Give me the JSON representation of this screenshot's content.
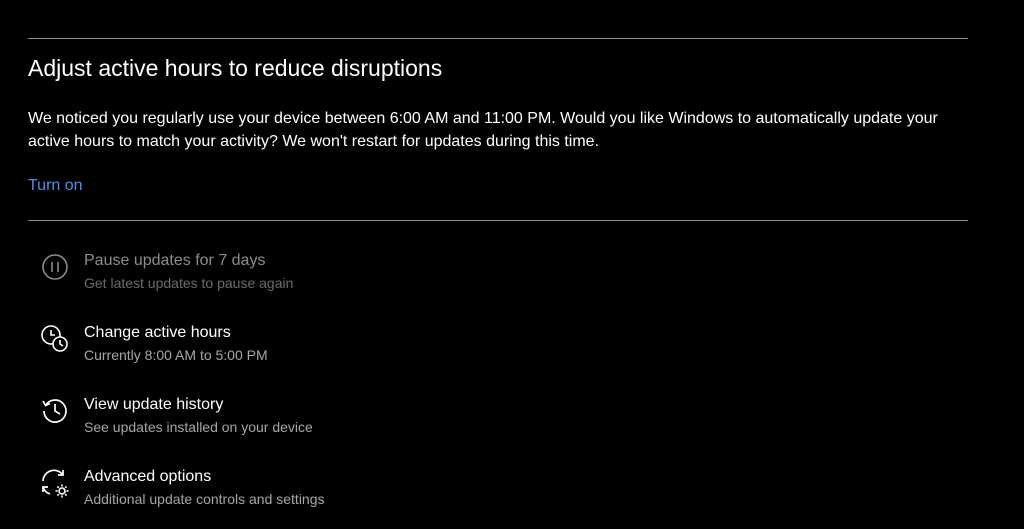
{
  "active_hours_prompt": {
    "heading": "Adjust active hours to reduce disruptions",
    "description": "We noticed you regularly use your device between 6:00 AM and 11:00 PM. Would you like Windows to automatically update your active hours to match your activity? We won't restart for updates during this time.",
    "turn_on_link": "Turn on",
    "link_color": "#4d8ee6"
  },
  "options": [
    {
      "icon": "pause-icon",
      "title": "Pause updates for 7 days",
      "subtitle": "Get latest updates to pause again",
      "enabled": false
    },
    {
      "icon": "active-hours-clock-icon",
      "title": "Change active hours",
      "subtitle": "Currently 8:00 AM to 5:00 PM",
      "enabled": true
    },
    {
      "icon": "history-icon",
      "title": "View update history",
      "subtitle": "See updates installed on your device",
      "enabled": true
    },
    {
      "icon": "advanced-sync-gear-icon",
      "title": "Advanced options",
      "subtitle": "Additional update controls and settings",
      "enabled": true
    }
  ]
}
